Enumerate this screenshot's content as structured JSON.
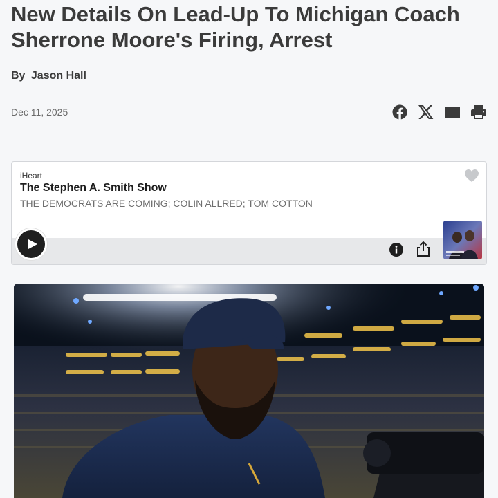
{
  "article": {
    "headline": "New Details On Lead-Up To Michigan Coach Sherrone Moore's Firing, Arrest",
    "byline_prefix": "By",
    "author": "Jason Hall",
    "date": "Dec 11, 2025"
  },
  "share": {
    "icons": [
      "facebook-icon",
      "x-icon",
      "email-icon",
      "print-icon"
    ]
  },
  "player": {
    "brand": "iHeart",
    "show_title": "The Stephen A. Smith Show",
    "episode_title": "THE DEMOCRATS ARE COMING; COLIN ALLRED; TOM COTTON",
    "icons": [
      "iheart-logo-icon",
      "play-icon",
      "info-icon",
      "share-icon"
    ]
  },
  "colors": {
    "background": "#f6f7f9",
    "text": "#3b3b3b",
    "player_bar": "#e7e8ea"
  }
}
